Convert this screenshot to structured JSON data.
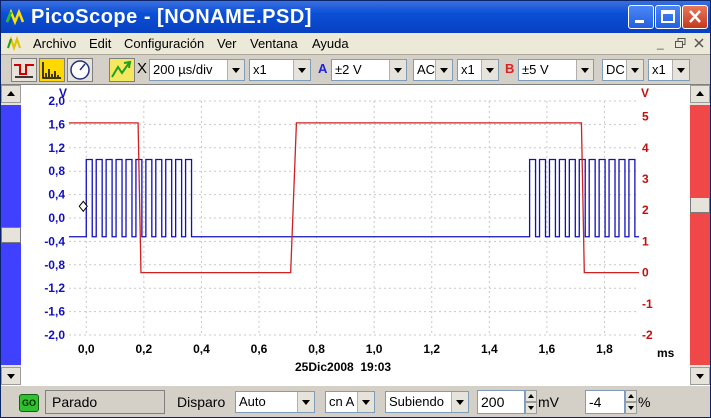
{
  "window": {
    "title": "PicoScope - [NONAME.PSD]"
  },
  "menu": {
    "items": [
      "Archivo",
      "Edit",
      "Configuración",
      "Ver",
      "Ventana",
      "Ayuda"
    ]
  },
  "toolbar": {
    "timebase_prefix": "X",
    "timebase": "200 µs/div",
    "timebase_mult": "x1",
    "channel_a": {
      "letter": "A",
      "range": "±2 V",
      "coupling": "AC",
      "mult": "x1",
      "color": "#2020e0"
    },
    "channel_b": {
      "letter": "B",
      "range": "±5 V",
      "coupling": "DC",
      "mult": "x1",
      "color": "#e02020"
    }
  },
  "status": {
    "go_label": "GO",
    "state": "Parado",
    "trigger_label": "Disparo",
    "trigger_mode": "Auto",
    "trigger_source": "cn A",
    "trigger_edge": "Subiendo",
    "trigger_level": "200",
    "trigger_unit": "mV",
    "pretrigger": "-4",
    "pretrigger_unit": "%"
  },
  "chart_data": {
    "type": "line",
    "timestamp": "25Dic2008  19:03",
    "x_unit": "ms",
    "xlim": [
      -0.06,
      1.92
    ],
    "x_ticks": [
      "0,0",
      "0,2",
      "0,4",
      "0,6",
      "0,8",
      "1,0",
      "1,2",
      "1,4",
      "1,6",
      "1,8"
    ],
    "left_axis": {
      "unit": "V",
      "color": "#1010c0",
      "ylim": [
        -2.0,
        2.0
      ],
      "ticks": [
        "2,0",
        "1,6",
        "1,2",
        "0,8",
        "0,4",
        "0,0",
        "-0,4",
        "-0,8",
        "-1,2",
        "-1,6",
        "-2,0"
      ]
    },
    "right_axis": {
      "unit": "V",
      "color": "#c01010",
      "ylim": [
        -2,
        5.5
      ],
      "ticks": [
        "5",
        "4",
        "3",
        "2",
        "1",
        "0",
        "-1",
        "-2"
      ]
    },
    "grid": true,
    "trigger_marker": {
      "x": 0.0,
      "y": 0.2
    },
    "series": [
      {
        "axis": "left",
        "color": "#1010c0",
        "kind": "burst",
        "low": -0.32,
        "high": 1.0,
        "bursts": [
          {
            "start": 0.0,
            "end": 0.38,
            "period": 0.0345
          },
          {
            "start": 1.54,
            "end": 1.92,
            "period": 0.0345
          }
        ]
      },
      {
        "axis": "right",
        "color": "#d02020",
        "kind": "step",
        "points": [
          [
            -0.06,
            4.8
          ],
          [
            0.18,
            4.8
          ],
          [
            0.19,
            0.0
          ],
          [
            0.71,
            0.0
          ],
          [
            0.73,
            4.8
          ],
          [
            1.72,
            4.8
          ],
          [
            1.73,
            0.0
          ],
          [
            1.92,
            0.0
          ]
        ]
      }
    ]
  }
}
